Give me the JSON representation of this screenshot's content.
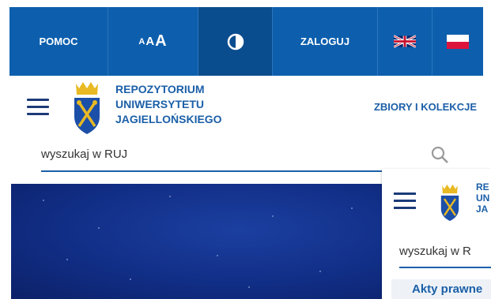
{
  "topbar": {
    "help_label": "POMOC",
    "font_size": {
      "small": "A",
      "medium": "A",
      "large": "A"
    },
    "contrast_icon": "contrast-icon",
    "login_label": "ZALOGUJ",
    "lang_en_icon": "uk-flag-icon",
    "lang_pl_icon": "pl-flag-icon"
  },
  "header": {
    "repo_name": {
      "line1": "REPOZYTORIUM",
      "line2": "UNIWERSYTETU",
      "line3": "JAGIELLOŃSKIEGO"
    },
    "collections_label": "ZBIORY I KOLEKCJE"
  },
  "search": {
    "placeholder": "wyszukaj w RUJ",
    "icon": "search-icon"
  },
  "overlay": {
    "repo_name": {
      "line1": "RE",
      "line2": "UN",
      "line3": "JA"
    },
    "search_placeholder": "wyszukaj w R",
    "link_label": "Akty prawne"
  },
  "colors": {
    "primary": "#0d5fad",
    "brand_text": "#1b5fa8",
    "banner": "#112e86"
  }
}
